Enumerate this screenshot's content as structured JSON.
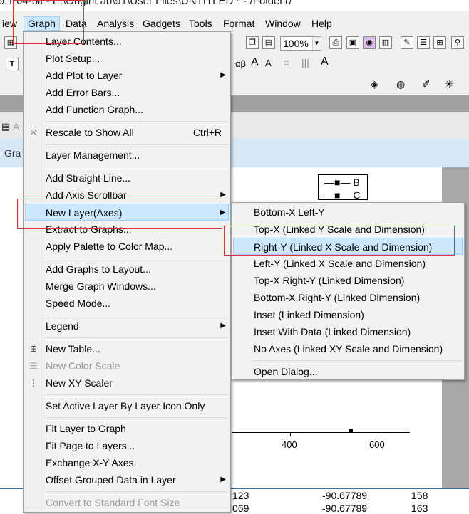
{
  "window": {
    "title": "9.1 64-bit - E:\\OriginLab\\91\\User Files\\UNTITLED * - /Folder1/"
  },
  "menubar": {
    "items": [
      {
        "label": "iew"
      },
      {
        "label": "Graph"
      },
      {
        "label": "Data"
      },
      {
        "label": "Analysis"
      },
      {
        "label": "Gadgets"
      },
      {
        "label": "Tools"
      },
      {
        "label": "Format"
      },
      {
        "label": "Window"
      },
      {
        "label": "Help"
      }
    ]
  },
  "toolbar": {
    "zoom_value": "100%",
    "font_tools": [
      "αβ",
      "A",
      "A"
    ]
  },
  "graph_window": {
    "tab_label": "Gra",
    "side_letter": "A"
  },
  "graph_menu": {
    "items": [
      {
        "label": "Layer Contents..."
      },
      {
        "label": "Plot Setup..."
      },
      {
        "label": "Add Plot to Layer",
        "arrow": "▶"
      },
      {
        "label": "Add Error Bars..."
      },
      {
        "label": "Add Function Graph..."
      },
      {
        "label": "Rescale to Show All",
        "shortcut": "Ctrl+R",
        "icon": "rescale-icon"
      },
      {
        "label": "Layer Management..."
      },
      {
        "label": "Add Straight Line..."
      },
      {
        "label": "Add Axis Scrollbar",
        "arrow": "▶"
      },
      {
        "label": "New Layer(Axes)",
        "arrow": "▶"
      },
      {
        "label": "Extract to Graphs..."
      },
      {
        "label": "Apply Palette to Color Map..."
      },
      {
        "label": "Add Graphs to Layout..."
      },
      {
        "label": "Merge Graph Windows..."
      },
      {
        "label": "Speed Mode..."
      },
      {
        "label": "Legend",
        "arrow": "▶"
      },
      {
        "label": "New Table...",
        "icon": "table-icon"
      },
      {
        "label": "New Color Scale",
        "icon": "color-scale-icon"
      },
      {
        "label": "New XY Scaler",
        "icon": "xy-scaler-icon"
      },
      {
        "label": "Set Active Layer By Layer Icon Only"
      },
      {
        "label": "Fit Layer to Graph"
      },
      {
        "label": "Fit Page to Layers..."
      },
      {
        "label": "Exchange X-Y Axes"
      },
      {
        "label": "Offset Grouped Data in Layer",
        "arrow": "▶"
      },
      {
        "label": "Convert to Standard Font Size"
      }
    ]
  },
  "submenu": {
    "items": [
      {
        "label": "Bottom-X Left-Y"
      },
      {
        "label": "Top-X (Linked Y Scale and Dimension)"
      },
      {
        "label": "Right-Y (Linked X Scale and Dimension)"
      },
      {
        "label": "Left-Y (Linked X Scale and Dimension)"
      },
      {
        "label": "Top-X Right-Y (Linked Dimension)"
      },
      {
        "label": "Bottom-X Right-Y (Linked Dimension)"
      },
      {
        "label": "Inset (Linked Dimension)"
      },
      {
        "label": "Inset With Data (Linked Dimension)"
      },
      {
        "label": "No Axes (Linked XY Scale and Dimension)"
      },
      {
        "label": "Open Dialog..."
      }
    ]
  },
  "chart": {
    "legend": [
      "B",
      "C"
    ],
    "x_ticks": [
      "400",
      "600"
    ]
  },
  "sheet": {
    "rows": [
      [
        "123",
        "-90.67789",
        "158"
      ],
      [
        "069",
        "-90.67789",
        "163"
      ]
    ]
  },
  "colors": {
    "highlight": "#cce8ff",
    "annotation": "#e03030"
  }
}
